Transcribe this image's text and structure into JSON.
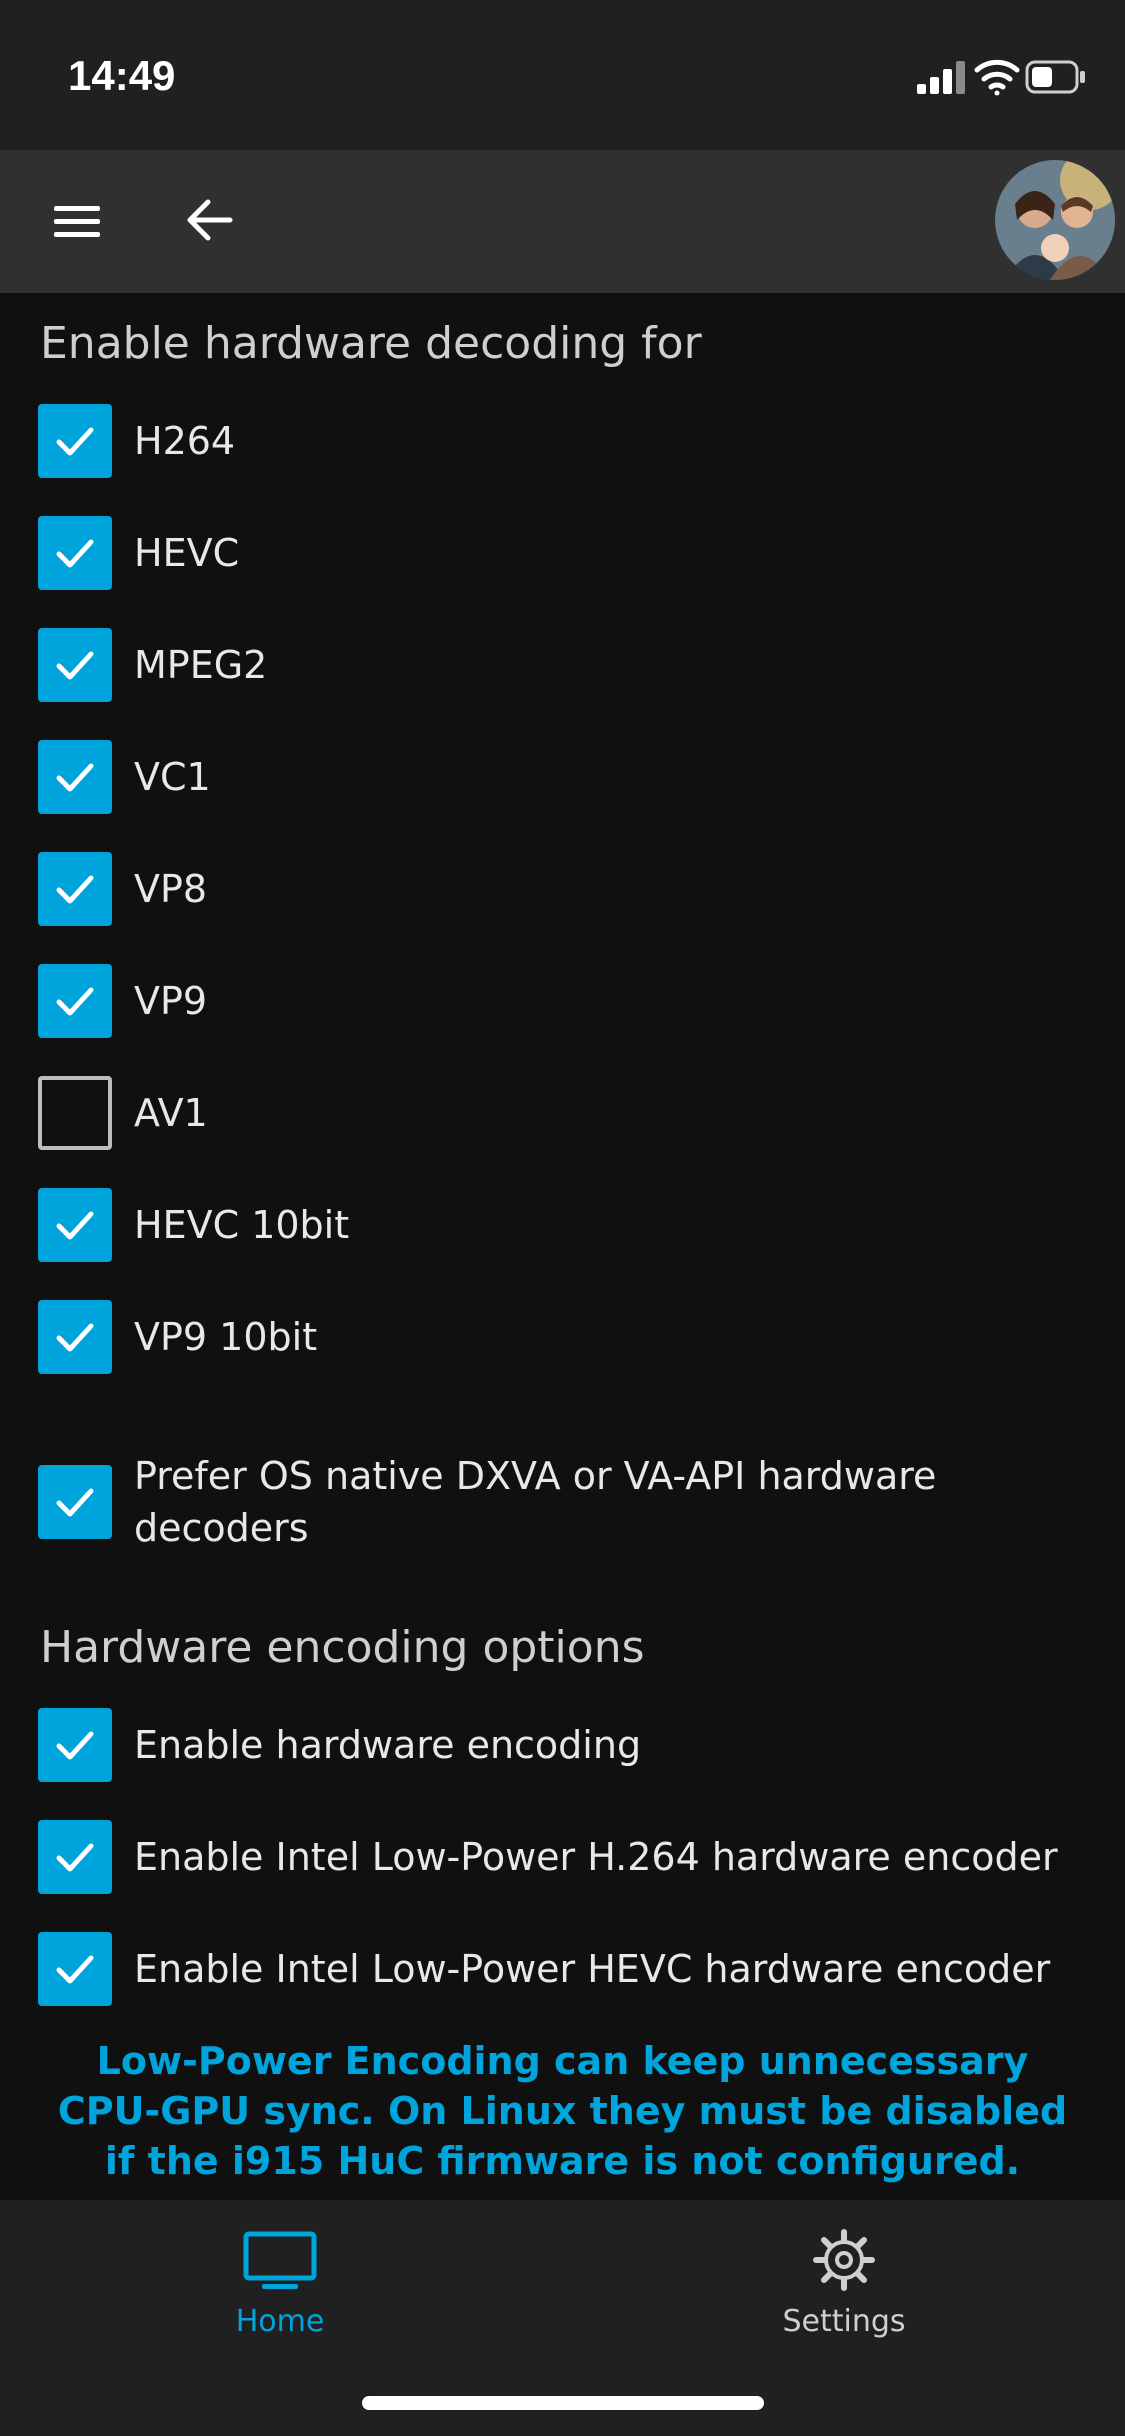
{
  "status_bar": {
    "time": "14:49"
  },
  "app_bar": {
    "menu_icon": "hamburger-menu-icon",
    "back_icon": "arrow-left-icon",
    "avatar": "user-avatar-photo"
  },
  "decoding": {
    "title": "Enable hardware decoding for",
    "items": [
      {
        "label": "H264",
        "checked": true
      },
      {
        "label": "HEVC",
        "checked": true
      },
      {
        "label": "MPEG2",
        "checked": true
      },
      {
        "label": "VC1",
        "checked": true
      },
      {
        "label": "VP8",
        "checked": true
      },
      {
        "label": "VP9",
        "checked": true
      },
      {
        "label": "AV1",
        "checked": false
      },
      {
        "label": "HEVC 10bit",
        "checked": true
      },
      {
        "label": "VP9 10bit",
        "checked": true
      }
    ],
    "prefer_native": {
      "label": "Prefer OS native DXVA or VA-API hardware decoders",
      "checked": true
    }
  },
  "encoding": {
    "title": "Hardware encoding options",
    "items": [
      {
        "label": "Enable hardware encoding",
        "checked": true
      },
      {
        "label": "Enable Intel Low-Power H.264 hardware encoder",
        "checked": true
      },
      {
        "label": "Enable Intel Low-Power HEVC hardware encoder",
        "checked": true
      }
    ],
    "notice": "Low-Power Encoding can keep unnecessary CPU-GPU sync. On Linux they must be disabled if the i915 HuC firmware is not configured."
  },
  "tabs": [
    {
      "label": "Home",
      "icon": "tv-icon",
      "active": true
    },
    {
      "label": "Settings",
      "icon": "gear-icon",
      "active": false
    }
  ],
  "colors": {
    "accent": "#00a4dc",
    "background": "#101010",
    "bar": "#303030"
  }
}
